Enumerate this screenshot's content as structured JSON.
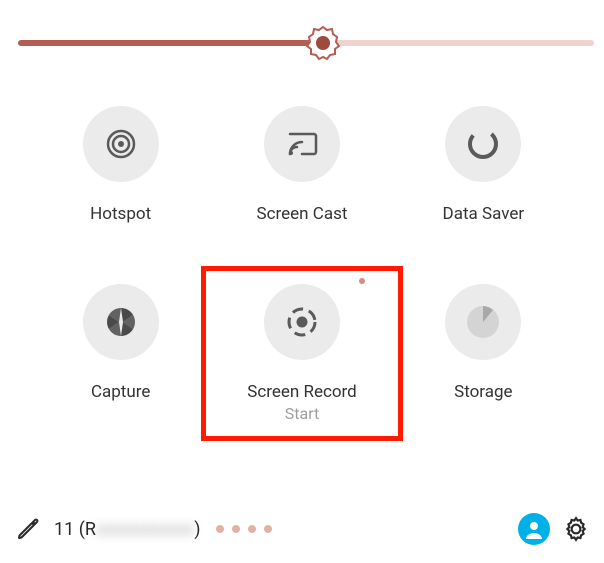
{
  "slider": {
    "value_percent": 53
  },
  "tiles": {
    "hotspot": {
      "label": "Hotspot"
    },
    "screencast": {
      "label": "Screen Cast"
    },
    "datasaver": {
      "label": "Data Saver"
    },
    "capture": {
      "label": "Capture"
    },
    "screenrecord": {
      "label": "Screen Record",
      "sublabel": "Start"
    },
    "storage": {
      "label": "Storage"
    }
  },
  "bottom": {
    "status_prefix": "11 (R",
    "status_blurred": "xxxxxxxxxxx",
    "status_suffix": ")",
    "pager_dots": 4
  },
  "colors": {
    "accent": "#b25e53",
    "highlight": "#ff1a00",
    "avatar": "#00b0e8"
  }
}
